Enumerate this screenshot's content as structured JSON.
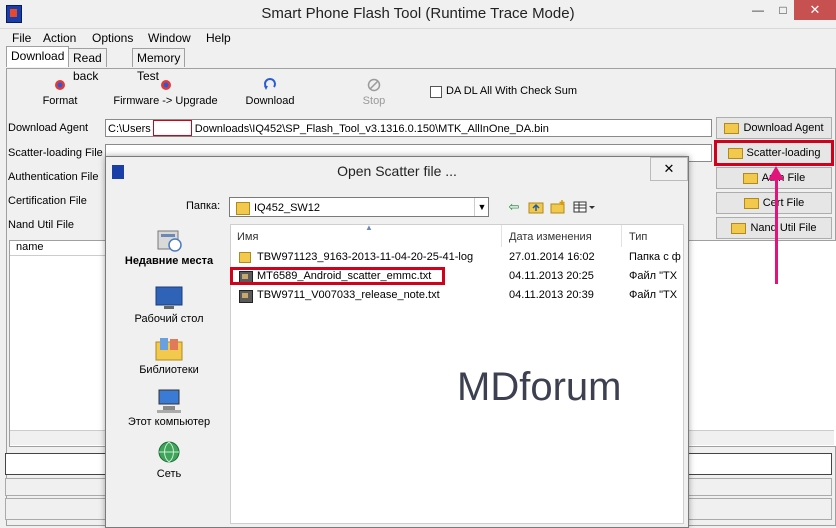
{
  "window": {
    "title": "Smart Phone Flash Tool (Runtime Trace Mode)",
    "min": "—",
    "max": "□",
    "close": "✕"
  },
  "menu": [
    "File",
    "Action",
    "Options",
    "Window",
    "Help"
  ],
  "tabs": [
    "Download",
    "Read back",
    "Memory Test"
  ],
  "toolbar": {
    "format": "Format",
    "firmware": "Firmware -> Upgrade",
    "download": "Download",
    "stop": "Stop",
    "checksum": "DA DL All With Check Sum"
  },
  "fields": {
    "download_agent": {
      "label": "Download Agent",
      "value_prefix": "C:\\Users",
      "value_suffix": "Downloads\\IQ452\\SP_Flash_Tool_v3.1316.0.150\\MTK_AllInOne_DA.bin"
    },
    "scatter": {
      "label": "Scatter-loading File"
    },
    "auth": {
      "label": "Authentication File"
    },
    "cert": {
      "label": "Certification File"
    },
    "nand": {
      "label": "Nand Util File"
    }
  },
  "side_buttons": {
    "download_agent": "Download Agent",
    "scatter": "Scatter-loading",
    "auth": "Auth File",
    "cert": "Cert File",
    "nand": "Nand Util File"
  },
  "list_header": "name",
  "dialog": {
    "title": "Open Scatter file ...",
    "close": "✕",
    "lookin_label": "Папка:",
    "lookin_value": "IQ452_SW12",
    "places": [
      "Недавние места",
      "Рабочий стол",
      "Библиотеки",
      "Этот компьютер",
      "Сеть"
    ],
    "columns": [
      "Имя",
      "Дата изменения",
      "Тип"
    ],
    "files": [
      {
        "name": "TBW971123_9163-2013-11-04-20-25-41-log",
        "date": "27.01.2014 16:02",
        "type": "Папка с ф"
      },
      {
        "name": "MT6589_Android_scatter_emmc.txt",
        "date": "04.11.2013 20:25",
        "type": "Файл \"TX"
      },
      {
        "name": "TBW9711_V007033_release_note.txt",
        "date": "04.11.2013 20:39",
        "type": "Файл \"TX"
      }
    ],
    "watermark": {
      "part1": "MD",
      "part2": "forum"
    }
  },
  "colors": {
    "highlight": "#d3001c",
    "arrow": "#e2147c",
    "close": "#c75050"
  }
}
